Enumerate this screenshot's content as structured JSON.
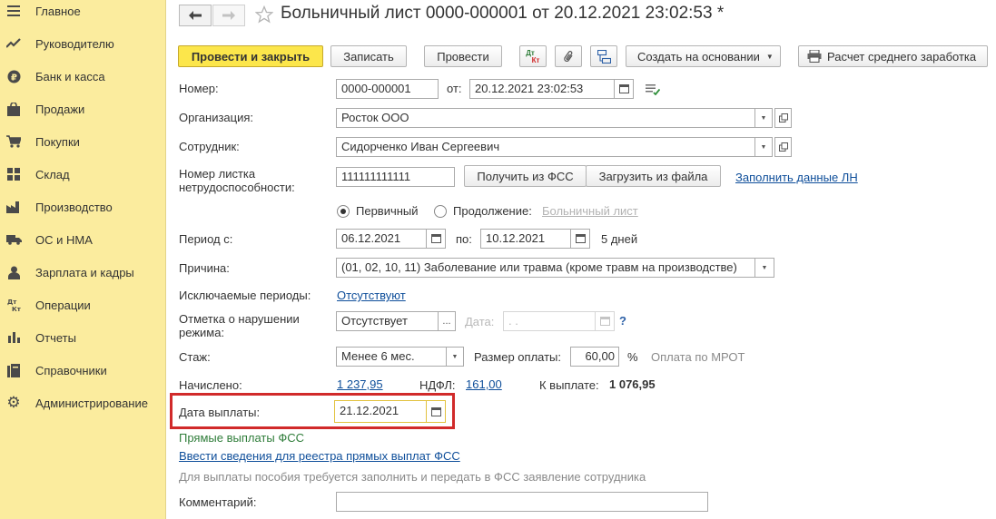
{
  "sidebar": {
    "items": [
      {
        "label": "Главное",
        "icon": "menu-icon"
      },
      {
        "label": "Руководителю",
        "icon": "trend-chart-icon"
      },
      {
        "label": "Банк и касса",
        "icon": "ruble-coin-icon"
      },
      {
        "label": "Продажи",
        "icon": "shopping-bag-icon"
      },
      {
        "label": "Покупки",
        "icon": "shopping-cart-icon"
      },
      {
        "label": "Склад",
        "icon": "warehouse-grid-icon"
      },
      {
        "label": "Производство",
        "icon": "factory-icon"
      },
      {
        "label": "ОС и НМА",
        "icon": "truck-icon"
      },
      {
        "label": "Зарплата и кадры",
        "icon": "person-icon"
      },
      {
        "label": "Операции",
        "icon": "dt-kt-icon"
      },
      {
        "label": "Отчеты",
        "icon": "bar-chart-icon"
      },
      {
        "label": "Справочники",
        "icon": "books-icon"
      },
      {
        "label": "Администрирование",
        "icon": "gear-icon"
      }
    ]
  },
  "header": {
    "title": "Больничный лист 0000-000001 от 20.12.2021 23:02:53 *"
  },
  "toolbar": {
    "post_and_close": "Провести и закрыть",
    "save": "Записать",
    "post": "Провести",
    "dtkt_top": "Дт",
    "dtkt_bottom": "Кт",
    "create_based_on": "Создать на основании",
    "avg_earnings": "Расчет среднего заработка"
  },
  "form": {
    "number_label": "Номер:",
    "number_value": "0000-000001",
    "date_from_label": "от:",
    "date_value": "20.12.2021 23:02:53",
    "organization_label": "Организация:",
    "organization_value": "Росток ООО",
    "employee_label": "Сотрудник:",
    "employee_value": "Сидорченко Иван Сергеевич",
    "sheet_number_label_1": "Номер листка",
    "sheet_number_label_2": "нетрудоспособности:",
    "sheet_number_value": "111111111111",
    "get_from_fss": "Получить из ФСС",
    "load_from_file": "Загрузить из файла",
    "fill_ln_data": "Заполнить данные ЛН",
    "primary_label": "Первичный",
    "continuation_label": "Продолжение:",
    "sick_list_link": "Больничный лист",
    "period_from_label": "Период с:",
    "period_from": "06.12.2021",
    "period_to_label": "по:",
    "period_to": "10.12.2021",
    "days_count": "5 дней",
    "reason_label": "Причина:",
    "reason_value": "(01, 02, 10, 11) Заболевание или травма (кроме травм на производстве)",
    "excluded_periods_label": "Исключаемые периоды:",
    "excluded_periods_link": "Отсутствуют",
    "violation_label_1": "Отметка о нарушении",
    "violation_label_2": "режима:",
    "violation_value": "Отсутствует",
    "violation_date_label": "Дата:",
    "violation_date_value": " .  .",
    "help_mark": "?",
    "experience_label": "Стаж:",
    "experience_value": "Менее 6 мес.",
    "payment_size_label": "Размер оплаты:",
    "payment_size_value": "60,00",
    "percent_sign": "%",
    "mrot_note": "Оплата по МРОТ",
    "accrued_label": "Начислено:",
    "accrued_value": "1 237,95",
    "ndfl_label": "НДФЛ:",
    "ndfl_value": "161,00",
    "to_pay_label": "К выплате:",
    "to_pay_value": "1 076,95",
    "pay_date_label": "Дата выплаты:",
    "pay_date_value": "21.12.2021",
    "direct_payments_fss": "Прямые выплаты ФСС",
    "enter_registry_link": "Ввести сведения для реестра прямых выплат ФСС",
    "benefit_note": "Для выплаты пособия требуется заполнить и передать в ФСС заявление сотрудника",
    "comment_label": "Комментарий:",
    "comment_value": ""
  },
  "colors": {
    "sidebar_bg": "#fbec9e",
    "primary_button": "#fce64b",
    "link": "#0e4e9a",
    "highlight_frame": "#d12a2a",
    "green_text": "#2f7d3a",
    "muted_text": "#8a8a8a"
  }
}
